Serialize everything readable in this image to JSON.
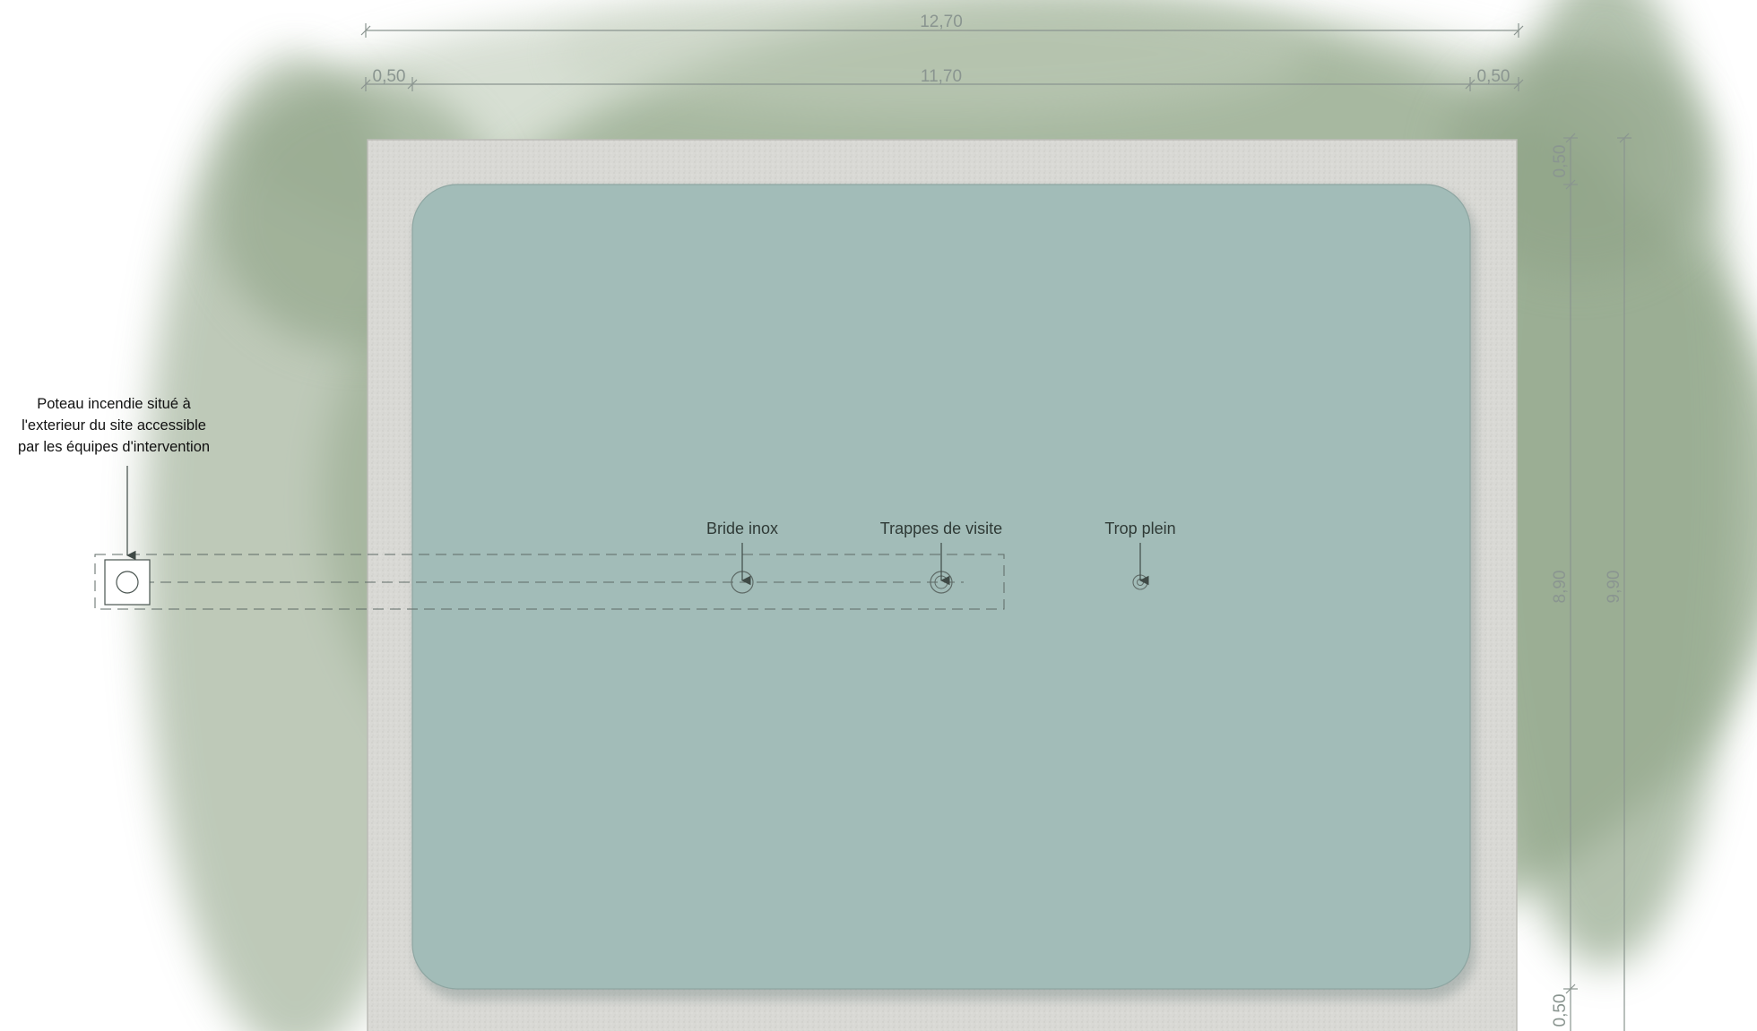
{
  "dimensions": {
    "overall_width": "12,70",
    "inner_width": "11,70",
    "margin_left": "0,50",
    "margin_right": "0,50",
    "margin_top": "0,50",
    "margin_bottom": "0,50",
    "inner_height": "8,90",
    "overall_height": "9,90"
  },
  "labels": {
    "bride": "Bride inox",
    "trappes": "Trappes de visite",
    "trop_plein": "Trop plein"
  },
  "note": {
    "line1": "Poteau incendie situé à",
    "line2": "l'exterieur du site accessible",
    "line3": "par les équipes d'intervention"
  },
  "colors": {
    "water": "#a2bcb8",
    "border_concrete": "#dadad6",
    "vegetation": "#8fa587",
    "dimension_line": "#8a9590",
    "annotation": "#3f4a46"
  }
}
